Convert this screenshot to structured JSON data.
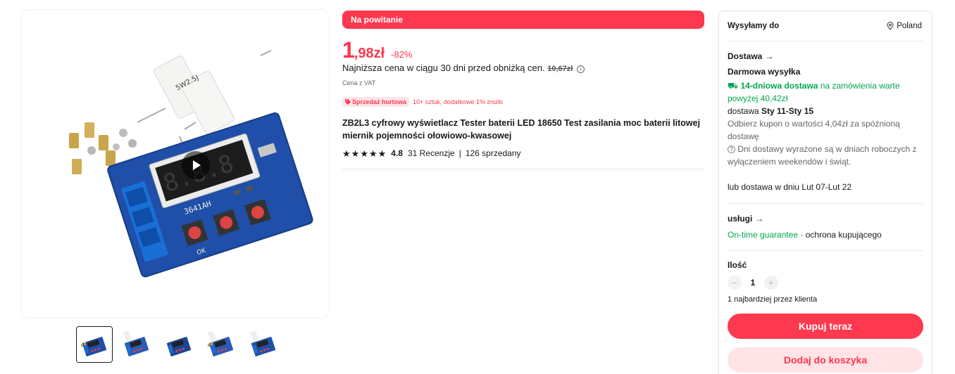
{
  "gallery": {
    "play_icon": "play-icon",
    "thumbnails": [
      "thumbnail-1",
      "thumbnail-2",
      "thumbnail-3",
      "thumbnail-4",
      "thumbnail-5"
    ],
    "module_label": "3641AH",
    "resistor_label": "5W2.5J",
    "ok_label": "OK"
  },
  "product": {
    "welcome_banner": "Na powitanie",
    "price_int": "1",
    "price_frac": ",98zł",
    "discount": "-82%",
    "lowest_price_text": "Najniższa cena w ciągu 30 dni przed obniżką cen.",
    "old_price": "10,67zł",
    "vat_note": "Cena z VAT",
    "bulk_badge": "Sprzedaż hurtowa",
    "bulk_text": "10+ sztuk, dodatkowe 1% zniżki",
    "title": "ZB2L3 cyfrowy wyświetlacz Tester baterii LED 18650 Test zasilania moc baterii litowej miernik pojemności ołowiowo-kwasowej",
    "rating_score": "4.8",
    "reviews": "31 Recenzje",
    "sold": "126 sprzedany",
    "accent_color": "#fd384f"
  },
  "panel": {
    "ship_to_label": "Wysyłamy do",
    "country": "Poland",
    "delivery_heading": "Dostawa",
    "free_shipping": "Darmowa wysyłka",
    "delivery_days": "14-dniowa dostawa",
    "delivery_condition_1": "na zamówienia warte",
    "delivery_condition_2": "powyżej 40,42zł",
    "delivery_prefix": "dostawa",
    "delivery_dates": "Sty 11-Sty 15",
    "coupon_text": "Odbierz kupon o wartości 4,04zł za spóźnioną dostawę",
    "business_days_note": "Dni dostawy wyrażone są w dniach roboczych z wyłączeniem weekendów i świąt.",
    "alt_delivery": "lub dostawa w dniu Lut 07-Lut 22",
    "services_heading": "usługi",
    "guarantee": "On-time guarantee",
    "buyer_protection": "· ochrona kupującego",
    "quantity_heading": "Ilość",
    "quantity_value": "1",
    "max_per_customer": "1 najbardziej przez klienta",
    "buy_now": "Kupuj teraz",
    "add_to_cart": "Dodaj do koszyka",
    "green_color": "#00a651"
  }
}
